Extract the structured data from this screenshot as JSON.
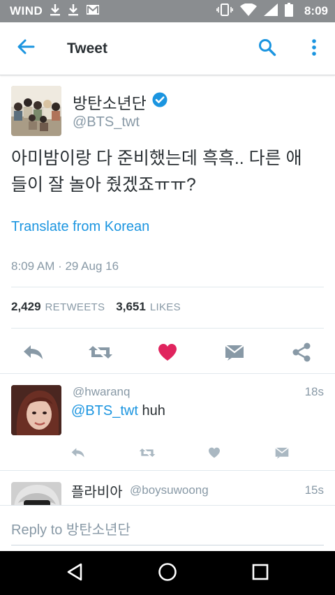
{
  "status_bar": {
    "carrier": "WIND",
    "time": "8:09",
    "left_icons": [
      "download-icon",
      "download-icon",
      "gmail-icon"
    ],
    "right_icons": [
      "vibrate-icon",
      "wifi-icon",
      "signal-icon",
      "battery-icon"
    ]
  },
  "app_bar": {
    "title": "Tweet",
    "back_icon": "arrow-left-icon",
    "search_icon": "search-icon",
    "more_icon": "more-vertical-icon"
  },
  "tweet": {
    "author_name": "방탄소년단",
    "verified": true,
    "author_handle": "@BTS_twt",
    "text_line1": "아미밤이랑 다 준비했는데 흑흑.. 다른 애",
    "text_line2": "들이 잘 놀아 줬겠죠ㅠㅠ?",
    "translate_label": "Translate from Korean",
    "timestamp": "8:09 AM · 29 Aug 16",
    "retweets_count": "2,429",
    "retweets_label": "RETWEETS",
    "likes_count": "3,651",
    "likes_label": "LIKES",
    "accent_color": "#1b95e0",
    "like_color": "#e0245e"
  },
  "replies": [
    {
      "handle": "@hwaranq",
      "time": "18s",
      "mention": "@BTS_twt",
      "text": " huh"
    },
    {
      "name": "플라비아",
      "handle": "@boysuwoong",
      "time": "15s"
    }
  ],
  "composer": {
    "placeholder": "Reply to 방탄소년단"
  },
  "nav_bar": {
    "buttons": [
      "back-triangle-icon",
      "home-circle-icon",
      "recents-square-icon"
    ]
  }
}
